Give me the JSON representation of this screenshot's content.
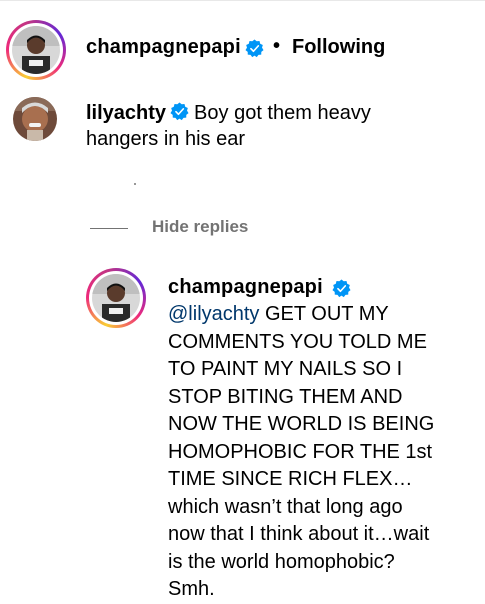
{
  "post": {
    "author": "champagnepapi",
    "separator": "•",
    "follow_status": "Following"
  },
  "comment": {
    "author": "lilyachty",
    "text": "Boy got them heavy hangers in his ear"
  },
  "replies_toggle": {
    "label": "Hide replies"
  },
  "reply": {
    "author": "champagnepapi",
    "mention": "@lilyachty",
    "text": "GET OUT MY COMMENTS YOU TOLD ME TO PAINT MY NAILS SO I STOP BITING THEM AND NOW THE WORLD IS BEING HOMOPHOBIC FOR THE 1st TIME SINCE RICH FLEX…which wasn’t that long ago now that I think about it…wait is the world homophobic? Smh."
  },
  "colors": {
    "verified_badge": "#0095f6",
    "mention_link": "#00376b",
    "secondary_text": "#737373"
  }
}
